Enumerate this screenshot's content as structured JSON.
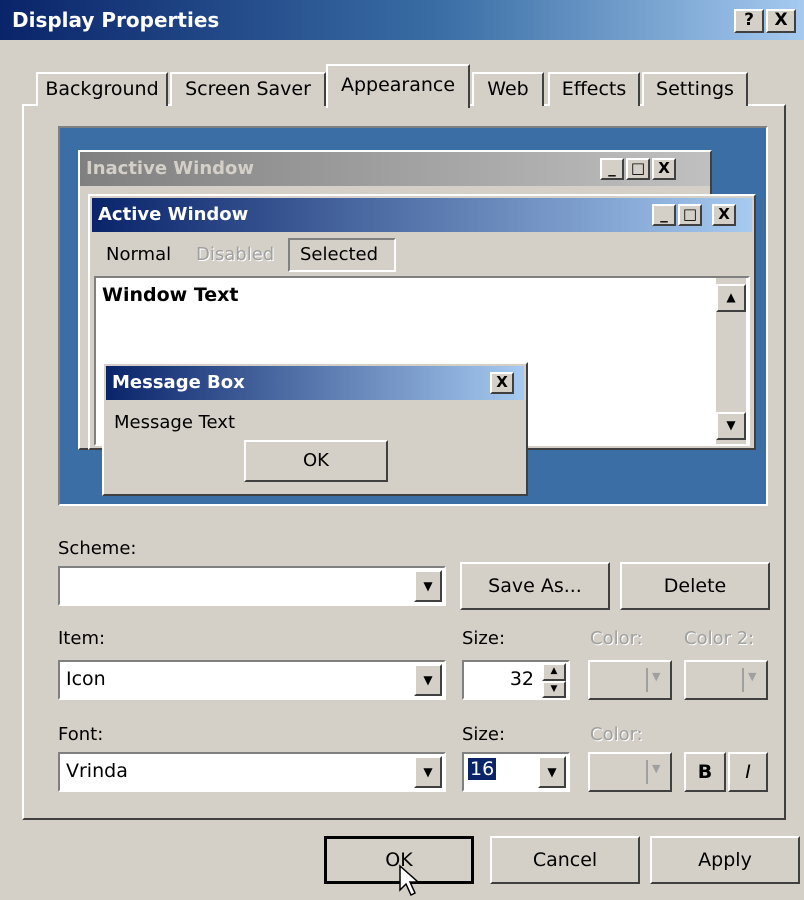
{
  "window": {
    "title": "Display Properties",
    "help_label": "?",
    "close_label": "X"
  },
  "tabs": [
    {
      "label": "Background"
    },
    {
      "label": "Screen Saver"
    },
    {
      "label": "Appearance"
    },
    {
      "label": "Web"
    },
    {
      "label": "Effects"
    },
    {
      "label": "Settings"
    }
  ],
  "active_tab": "Appearance",
  "preview": {
    "inactive_title": "Inactive Window",
    "active_title": "Active Window",
    "menu": {
      "normal": "Normal",
      "disabled": "Disabled",
      "selected": "Selected"
    },
    "window_text": "Window Text",
    "message_box": {
      "title": "Message Box",
      "text": "Message Text",
      "ok_label": "OK",
      "close_label": "X"
    },
    "caption_buttons": {
      "minimize": "_",
      "maximize": "□",
      "close": "X"
    },
    "colors": {
      "desktop": "#3a6ea5",
      "active_title": "#0a246a",
      "inactive_title": "#808080"
    }
  },
  "scheme": {
    "label": "Scheme:",
    "value": "",
    "save_as_label": "Save As...",
    "delete_label": "Delete"
  },
  "item": {
    "label": "Item:",
    "value": "Icon",
    "size_label": "Size:",
    "size_value": "32",
    "color_label": "Color:",
    "color2_label": "Color 2:"
  },
  "font": {
    "label": "Font:",
    "value": "Vrinda",
    "size_label": "Size:",
    "size_value": "16",
    "color_label": "Color:",
    "bold_label": "B",
    "italic_label": "I"
  },
  "footer": {
    "ok_label": "OK",
    "cancel_label": "Cancel",
    "apply_label": "Apply"
  }
}
